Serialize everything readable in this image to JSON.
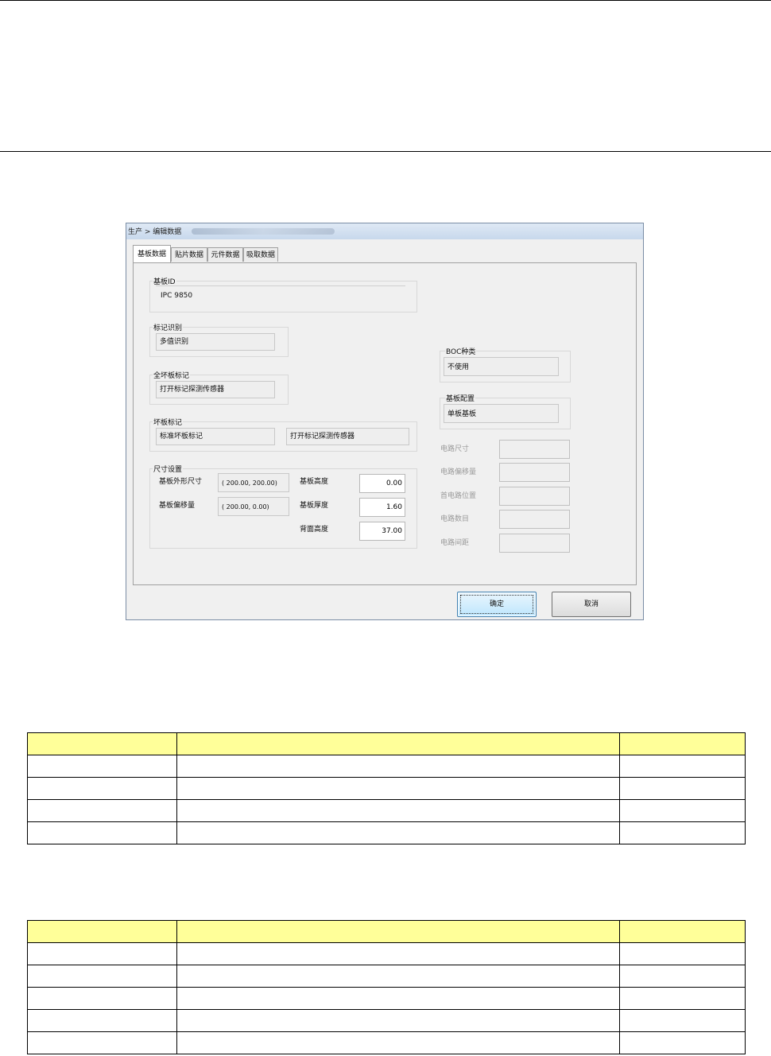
{
  "dialog": {
    "title": "生产 > 编辑数据",
    "tabs": [
      "基板数据",
      "贴片数据",
      "元件数据",
      "吸取数据"
    ],
    "active_tab": 0,
    "board_id": {
      "label": "基板ID",
      "value": "IPC 9850"
    },
    "mark_recognition": {
      "label": "标记识别",
      "value": "多值识别"
    },
    "all_bad_mark": {
      "label": "全坏板标记",
      "value": "打开标记探测传感器"
    },
    "bad_mark": {
      "label": "坏板标记",
      "value1": "标准坏板标记",
      "value2": "打开标记探测传感器"
    },
    "bc_type": {
      "label": "BOC种类",
      "value": "不使用"
    },
    "board_config": {
      "label": "基板配置",
      "value": "单板基板"
    },
    "circuit_fields": [
      "电路尺寸",
      "电路偏移量",
      "首电路位置",
      "电路数目",
      "电路间距"
    ],
    "size": {
      "label": "尺寸设置",
      "outline_label": "基板外形尺寸",
      "outline_value": "( 200.00,  200.00)",
      "offset_label": "基板偏移量",
      "offset_value": "( 200.00,    0.00)",
      "height_label": "基板高度",
      "height_value": "0.00",
      "thickness_label": "基板厚度",
      "thickness_value": "1.60",
      "back_height_label": "背面高度",
      "back_height_value": "37.00"
    },
    "ok_label": "确定",
    "cancel_label": "取消"
  },
  "tables": [
    {
      "rows": 5,
      "cols": 3
    },
    {
      "rows": 6,
      "cols": 3
    }
  ]
}
